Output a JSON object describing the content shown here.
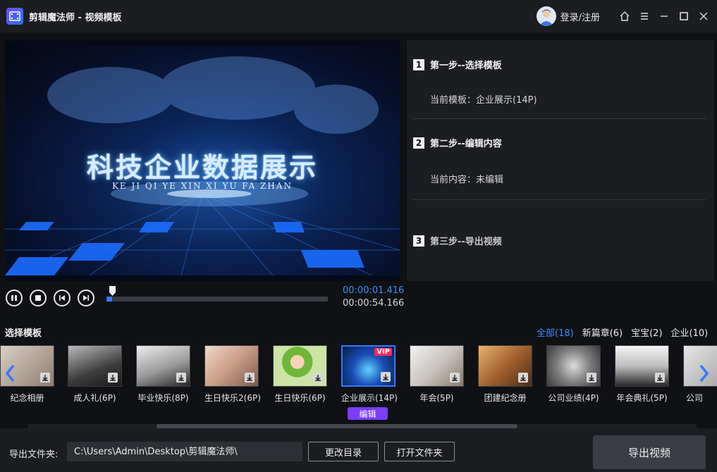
{
  "titlebar": {
    "title": "剪辑魔法师 - 视频模板",
    "login_label": "登录/注册",
    "icons": [
      "home-icon",
      "menu-icon",
      "minimize-icon",
      "maximize-icon",
      "close-icon"
    ]
  },
  "preview": {
    "title_text": "科技企业数据展示",
    "subtitle_text": "KE JI QI YE XIN XI YU FA ZHAN"
  },
  "player": {
    "current_time": "00:00:01.416",
    "total_time": "00:00:54.166",
    "progress_fraction": 0.026,
    "accent_color": "#2f7bff"
  },
  "steps": [
    {
      "num": "1",
      "label": "第一步--选择模板",
      "info": "当前模板：企业展示(14P)"
    },
    {
      "num": "2",
      "label": "第二步--编辑内容",
      "info": "当前内容：未编辑"
    },
    {
      "num": "3",
      "label": "第三步--导出视频",
      "info": ""
    }
  ],
  "templates_section": {
    "title": "选择模板",
    "filters": [
      {
        "label": "全部(18)",
        "active": true
      },
      {
        "label": "新篇章(6)",
        "active": false
      },
      {
        "label": "宝宝(2)",
        "active": false
      },
      {
        "label": "企业(10)",
        "active": false
      }
    ],
    "items": [
      {
        "name": "纪念相册",
        "selected": false,
        "vip": false
      },
      {
        "name": "成人礼(6P)",
        "selected": false,
        "vip": false
      },
      {
        "name": "毕业快乐(8P)",
        "selected": false,
        "vip": false
      },
      {
        "name": "生日快乐2(6P)",
        "selected": false,
        "vip": false
      },
      {
        "name": "生日快乐(6P)",
        "selected": false,
        "vip": false
      },
      {
        "name": "企业展示(14P)",
        "selected": true,
        "vip": true
      },
      {
        "name": "年会(5P)",
        "selected": false,
        "vip": false
      },
      {
        "name": "团建纪念册",
        "selected": false,
        "vip": false
      },
      {
        "name": "公司业绩(4P)",
        "selected": false,
        "vip": false
      },
      {
        "name": "年会典礼(5P)",
        "selected": false,
        "vip": false
      },
      {
        "name": "公司",
        "selected": false,
        "vip": false
      }
    ],
    "vip_label": "VIP",
    "edit_label": "编辑"
  },
  "footer": {
    "output_label": "导出文件夹:",
    "output_path": "C:\\Users\\Admin\\Desktop\\剪辑魔法师\\",
    "change_dir_label": "更改目录",
    "open_folder_label": "打开文件夹",
    "export_label": "导出视频"
  }
}
